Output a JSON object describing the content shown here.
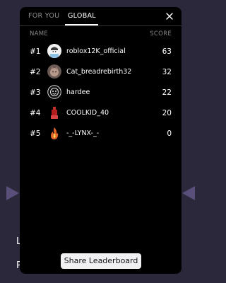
{
  "tabs": [
    {
      "label": "FOR YOU",
      "active": false
    },
    {
      "label": "GLOBAL",
      "active": true
    }
  ],
  "table": {
    "name_header": "NAME",
    "score_header": "SCORE"
  },
  "rows": [
    {
      "rank": "#1",
      "name": "roblox12K_official",
      "score": "63",
      "avatar": "roblox-avatar-icon"
    },
    {
      "rank": "#2",
      "name": "Cat_breadrebirth32",
      "score": "32",
      "avatar": "cat-avatar-icon"
    },
    {
      "rank": "#3",
      "name": "hardee",
      "score": "22",
      "avatar": "mask-avatar-icon"
    },
    {
      "rank": "#4",
      "name": "COOLKID_40",
      "score": "20",
      "avatar": "red-character-avatar-icon"
    },
    {
      "rank": "#5",
      "name": "-_-LYNX-_-",
      "score": "0",
      "avatar": "fire-avatar-icon"
    }
  ],
  "share_button": "Share Leaderboard",
  "background": {
    "text_line_1": "L",
    "text_line_2": "P"
  },
  "colors": {
    "page_background": "#2c283b",
    "modal_background": "#000000",
    "accent_arrow": "#5a4f7a",
    "button_background": "#f1f1f4"
  }
}
